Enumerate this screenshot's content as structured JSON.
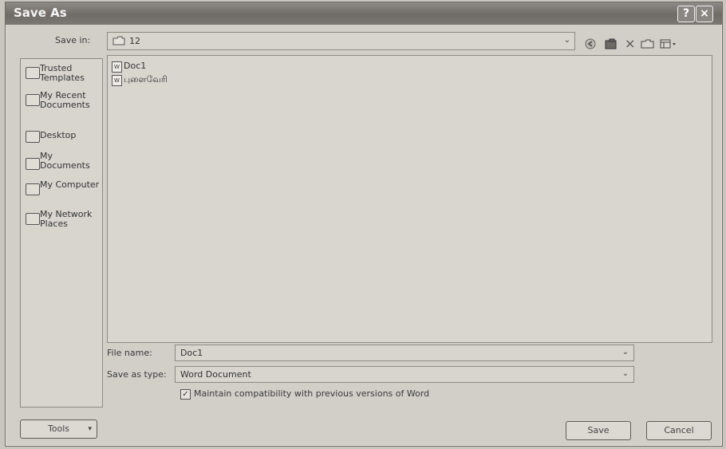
{
  "window": {
    "title": "Save As"
  },
  "titlebar": {
    "help_label": "?",
    "close_label": "×"
  },
  "save_in": {
    "label": "Save in:",
    "value": "12"
  },
  "toolbar": {
    "delete_label": "×"
  },
  "places": [
    {
      "label": "Trusted Templates"
    },
    {
      "label": "My Recent Documents"
    },
    {
      "label": "Desktop"
    },
    {
      "label": "My Documents"
    },
    {
      "label": "My Computer"
    },
    {
      "label": "My Network Places"
    }
  ],
  "files": [
    {
      "name": "Doc1",
      "icon": "word-doc-icon"
    },
    {
      "name": "புளைவேரி",
      "icon": "word-doc-icon"
    }
  ],
  "file_name": {
    "label": "File name:",
    "value": "Doc1"
  },
  "save_as_type": {
    "label": "Save as type:",
    "value": "Word Document"
  },
  "compat": {
    "label": "Maintain compatibility with previous versions of Word",
    "checked": true
  },
  "buttons": {
    "tools": "Tools",
    "save": "Save",
    "cancel": "Cancel"
  }
}
